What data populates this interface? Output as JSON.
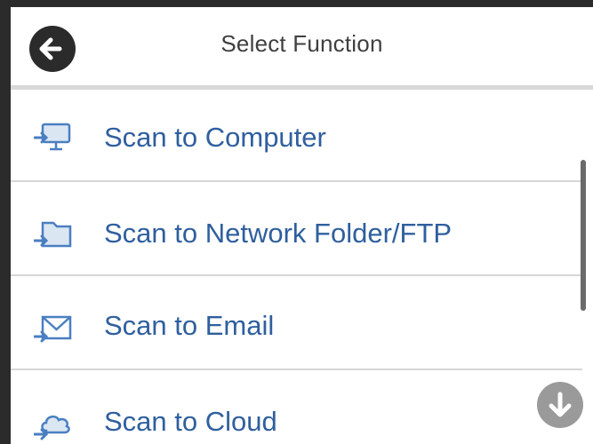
{
  "header": {
    "title": "Select Function",
    "back_icon": "arrow-left-icon"
  },
  "menu": {
    "items": [
      {
        "label": "Scan to Computer",
        "icon": "scan-to-computer-icon"
      },
      {
        "label": "Scan to Network Folder/FTP",
        "icon": "scan-to-folder-icon"
      },
      {
        "label": "Scan to Email",
        "icon": "scan-to-email-icon"
      },
      {
        "label": "Scan to Cloud",
        "icon": "scan-to-cloud-icon"
      }
    ]
  },
  "scroll": {
    "down_icon": "arrow-down-icon"
  },
  "colors": {
    "accent": "#2f5f9e",
    "icon_blue": "#4a7fc1",
    "frame": "#2b2b2b"
  }
}
